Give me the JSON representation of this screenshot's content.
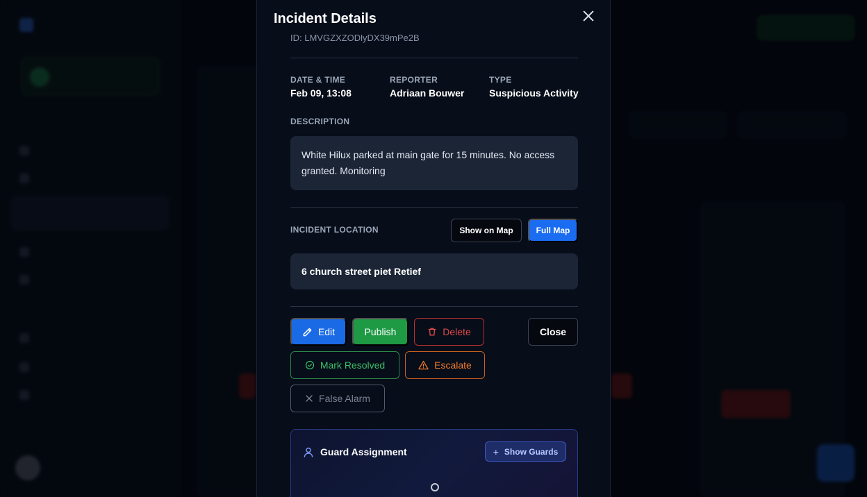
{
  "modal": {
    "title": "Incident Details",
    "id_line": "ID: LMVGZXZODlyDX39mPe2B"
  },
  "meta": {
    "date_label": "DATE & TIME",
    "date_value": "Feb 09, 13:08",
    "reporter_label": "REPORTER",
    "reporter_value": "Adriaan Bouwer",
    "type_label": "TYPE",
    "type_value": "Suspicious Activity"
  },
  "description": {
    "label": "DESCRIPTION",
    "text": "White Hilux parked at main gate for 15 minutes. No access granted. Monitoring"
  },
  "location": {
    "label": "INCIDENT LOCATION",
    "show_on_map": "Show on Map",
    "full_map": "Full Map",
    "address": "6 church street piet Retief"
  },
  "actions": {
    "edit": "Edit",
    "publish": "Publish",
    "delete": "Delete",
    "close": "Close",
    "mark_resolved": "Mark Resolved",
    "escalate": "Escalate",
    "false_alarm": "False Alarm"
  },
  "guard": {
    "title": "Guard Assignment",
    "show_guards": "Show Guards"
  },
  "colors": {
    "primary": "#1a6ae6",
    "success": "#1e9a45",
    "danger": "#e04a4a",
    "warning": "#f07a2a"
  }
}
